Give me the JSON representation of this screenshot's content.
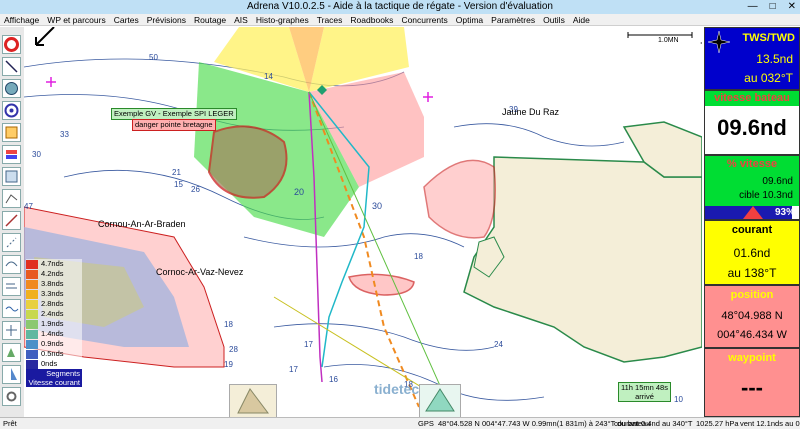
{
  "window": {
    "title": "Adrena V10.0.2.5 - Aide à la tactique de régate - Version d'évaluation",
    "min": "—",
    "max": "□",
    "close": "✕"
  },
  "menu": [
    "Affichage",
    "WP et parcours",
    "Cartes",
    "Prévisions",
    "Routage",
    "AIS",
    "Histo-graphes",
    "Traces",
    "Roadbooks",
    "Concurrents",
    "Optima",
    "Paramètres",
    "Outils",
    "Aide"
  ],
  "map": {
    "scale_label": "1.0MN",
    "place_labels": {
      "jaune_du_raz": "Jaune Du Raz",
      "cornou_braden": "Cornou-An-Ar-Braden",
      "cornoc_vaz": "Cornoc-Ar-Vaz-Nevez"
    },
    "sail_label": "Exemple GV - Exemple SPI LEGER",
    "danger_label": "danger pointe bretagne",
    "eta": {
      "time": "11h 15mn 48s",
      "label": "arrivé"
    },
    "watermark": "tidetech",
    "depth_numbers": [
      "50",
      "33",
      "30",
      "21",
      "15",
      "26",
      "20",
      "30",
      "47",
      "14",
      "39",
      "20",
      "18",
      "17",
      "16",
      "24",
      "18",
      "18",
      "28",
      "19",
      "17",
      "16",
      "10"
    ]
  },
  "legend": {
    "speeds": [
      "4.7nds",
      "4.2nds",
      "3.8nds",
      "3.3nds",
      "2.8nds",
      "2.4nds",
      "1.9nds",
      "1.4nds",
      "0.9nds",
      "0.5nds",
      "0nds"
    ],
    "colors": [
      "#e03020",
      "#e85a20",
      "#f08a20",
      "#f0b020",
      "#e8d040",
      "#c8d850",
      "#8cc870",
      "#60b8a0",
      "#4c90c8",
      "#4060c0",
      "#2a2aa0"
    ],
    "segments": "Segments",
    "vitesse_courant": "Vitesse courant"
  },
  "panels": {
    "tws": {
      "title": "TWS/TWD",
      "speed": "13.5nd",
      "dir": "au 032°T"
    },
    "boat": {
      "title": "vitesse bateau",
      "value": "09.6nd"
    },
    "pct": {
      "title": "% vitesse",
      "value": "09.6nd",
      "target": "cible 10.3nd",
      "percent": "93%",
      "fill": 0.93
    },
    "current": {
      "title": "courant",
      "value": "01.6nd",
      "dir": "au 138°T"
    },
    "position": {
      "title": "position",
      "lat": "48°04.988 N",
      "lon": "004°46.434 W"
    },
    "waypoint": {
      "title": "waypoint",
      "value": "---"
    }
  },
  "status": {
    "ready": "Prêt",
    "gps": "GPS",
    "gps_pos": "48°04.528 N",
    "cursor": "004°47.743 W 0.99mn(1 831m) à 243°T du bateau",
    "current": "courant 0.4nd au 340°T",
    "pressure": "1025.27 hPa",
    "wind": "vent 12.1nds au 026°"
  }
}
